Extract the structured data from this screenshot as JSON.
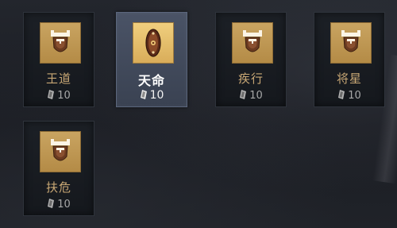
{
  "cards": [
    {
      "name": "王道",
      "cost": "10",
      "selected": false,
      "icon": "gate-shield-icon"
    },
    {
      "name": "天命",
      "cost": "10",
      "selected": true,
      "icon": "oval-shield-icon"
    },
    {
      "name": "疾行",
      "cost": "10",
      "selected": false,
      "icon": "gate-shield-icon"
    },
    {
      "name": "将星",
      "cost": "10",
      "selected": false,
      "icon": "gate-shield-icon"
    },
    {
      "name": "扶危",
      "cost": "10",
      "selected": false,
      "icon": "gate-shield-icon"
    }
  ],
  "colors": {
    "gold": "#c9a461",
    "selected_bg": "#4a5366",
    "name_text": "#c9a875"
  },
  "currency_icon": "scroll-token-icon"
}
